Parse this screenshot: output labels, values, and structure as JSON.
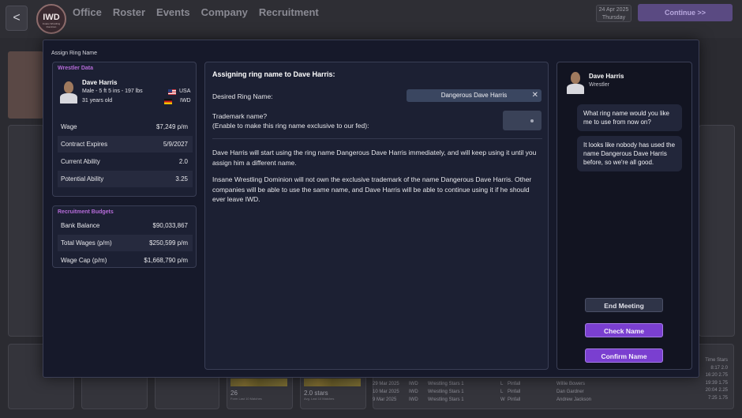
{
  "topbar": {
    "back_label": "<",
    "logo_text": "IWD",
    "logo_subtext": "Insane Wrestling Dominion",
    "nav": [
      "Office",
      "Roster",
      "Events",
      "Company",
      "Recruitment"
    ],
    "date": "24 Apr 2025",
    "weekday": "Thursday",
    "continue_label": "Continue >>"
  },
  "modal": {
    "title": "Assign Ring Name",
    "wrestler_data": {
      "header": "Wrestler Data",
      "name": "Dave Harris",
      "details": "Male - 5 ft 5 ins - 197 lbs",
      "age": "31 years old",
      "nationality": "USA",
      "company": "IWD",
      "stats": [
        {
          "label": "Wage",
          "value": "$7,249 p/m"
        },
        {
          "label": "Contract Expires",
          "value": "5/9/2027"
        },
        {
          "label": "Current Ability",
          "value": "2.0"
        },
        {
          "label": "Potential Ability",
          "value": "3.25"
        }
      ]
    },
    "recruitment_budgets": {
      "header": "Recruitment Budgets",
      "stats": [
        {
          "label": "Bank Balance",
          "value": "$90,033,867"
        },
        {
          "label": "Total Wages (p/m)",
          "value": "$250,599 p/m"
        },
        {
          "label": "Wage Cap (p/m)",
          "value": "$1,668,790 p/m"
        }
      ]
    },
    "main": {
      "heading": "Assigning ring name to Dave Harris:",
      "desired_label": "Desired Ring Name:",
      "ring_name_value": "Dangerous Dave Harris",
      "clear_icon": "✕",
      "trademark_label": "Trademark name?",
      "trademark_sub": "(Enable to make this ring name exclusive to our fed):",
      "paragraph1": "Dave Harris will start using the ring name Dangerous Dave Harris immediately, and will keep using it until you assign him a different name.",
      "paragraph2": "Insane Wrestling Dominion will not own the exclusive trademark of the name Dangerous Dave Harris. Other companies will be able to use the same name, and Dave Harris will be able to continue using it if he should ever leave IWD."
    },
    "chat": {
      "name": "Dave Harris",
      "role": "Wrestler",
      "messages": [
        "What ring name would you like me to use from now on?",
        "It looks like nobody has used the name Dangerous Dave Harris before, so we're all good."
      ],
      "end_meeting": "End Meeting",
      "check_name": "Check Name",
      "confirm_name": "Confirm Name"
    }
  },
  "background": {
    "stat1_value": "26",
    "stat1_caption": "Form Last 10 Matches",
    "stat2_value": "2.0 stars",
    "stat2_caption": "Avg. Last 10 Matches",
    "history_rows": [
      [
        "29 Mar 2025",
        "IWD",
        "Wrestling Stars 1",
        "L",
        "Pinfall",
        "Willie Bowers"
      ],
      [
        "10 Mar 2025",
        "IWD",
        "Wrestling Stars 1",
        "L",
        "Pinfall",
        "Dan Gardner"
      ],
      [
        "9 Mar 2025",
        "IWD",
        "Wrestling Stars 1",
        "W",
        "Pinfall",
        "Andrew Jackson"
      ]
    ],
    "right_col_header": "Time  Stars",
    "right_col_rows": [
      "8:17  2.0",
      "16:20  2.75",
      "19:39  1.75",
      "20:04  2.25",
      "7:25  1.75"
    ]
  }
}
